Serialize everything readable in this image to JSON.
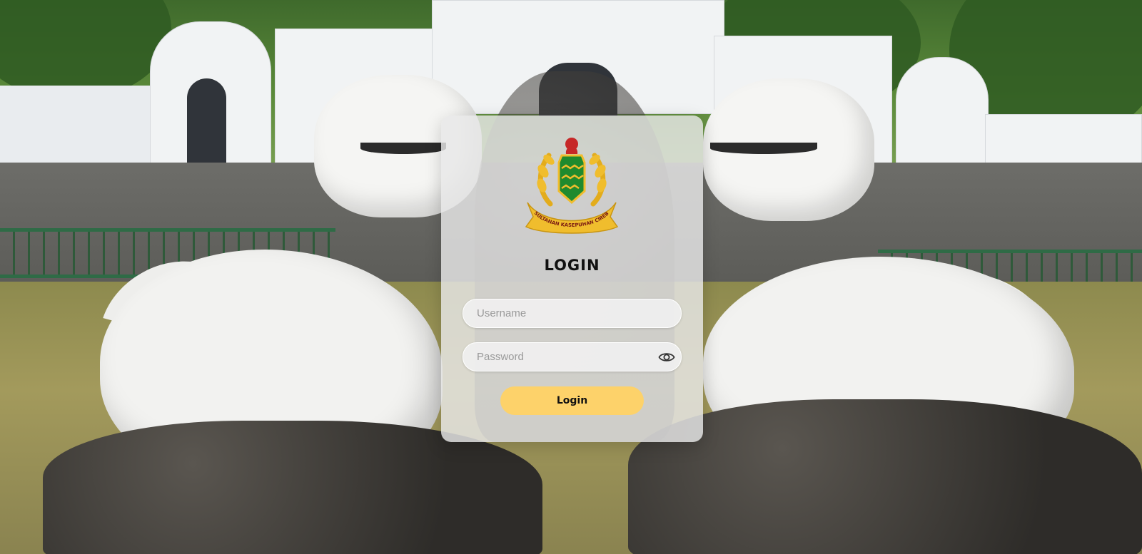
{
  "logo": {
    "name": "kasepuhan-crest",
    "text": "KASULTANAN KASEPUHAN CIREBON",
    "colors": {
      "gold": "#e3ac1c",
      "green": "#1f8a2e",
      "red": "#c62828"
    }
  },
  "login": {
    "title": "LOGIN",
    "username_placeholder": "Username",
    "password_placeholder": "Password",
    "show_password_icon": "eye-icon",
    "button_label": "Login"
  },
  "theme": {
    "card_bg": "rgba(232,232,232,0.82)",
    "button_color": "#fdd26a"
  }
}
